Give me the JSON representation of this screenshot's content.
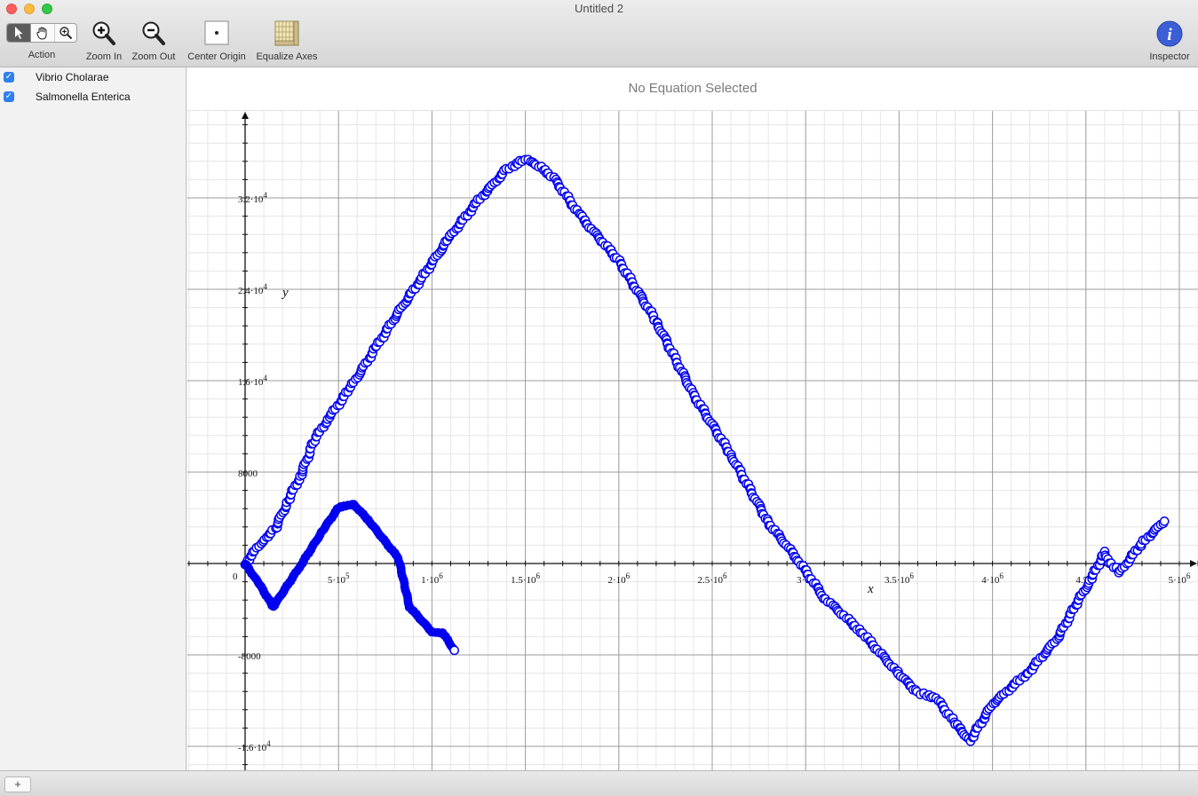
{
  "window": {
    "title": "Untitled 2"
  },
  "toolbar": {
    "action_label": "Action",
    "zoom_in_label": "Zoom In",
    "zoom_out_label": "Zoom Out",
    "center_origin_label": "Center Origin",
    "equalize_axes_label": "Equalize Axes",
    "inspector_label": "Inspector",
    "action_tools": [
      "arrow-pointer",
      "hand-pan",
      "zoom-magnifier"
    ],
    "active_tool": "arrow-pointer"
  },
  "sidebar": {
    "items": [
      {
        "label": "Vibrio Cholarae",
        "checked": true
      },
      {
        "label": "Salmonella Enterica",
        "checked": true
      }
    ]
  },
  "equation_bar": {
    "text": "No Equation Selected"
  },
  "bottom": {
    "add_label": "+"
  },
  "colors": {
    "series": "#0000ee",
    "accent": "#2f7ff0",
    "inspector": "#3c5fd6"
  },
  "chart_data": {
    "type": "scatter",
    "xlabel": "x",
    "ylabel": "y",
    "xlim": [
      -300000,
      5100000
    ],
    "ylim": [
      -18000,
      40000
    ],
    "grid": true,
    "x_ticks": [
      {
        "value": 0,
        "label": "0"
      },
      {
        "value": 500000,
        "label": "5·10",
        "exp": "5"
      },
      {
        "value": 1000000,
        "label": "1·10",
        "exp": "6"
      },
      {
        "value": 1500000,
        "label": "1.5·10",
        "exp": "6"
      },
      {
        "value": 2000000,
        "label": "2·10",
        "exp": "6"
      },
      {
        "value": 2500000,
        "label": "2.5·10",
        "exp": "6"
      },
      {
        "value": 3000000,
        "label": "3·10",
        "exp": ""
      },
      {
        "value": 3500000,
        "label": "3.5·10",
        "exp": "6"
      },
      {
        "value": 4000000,
        "label": "4·10",
        "exp": "6"
      },
      {
        "value": 4500000,
        "label": "4.5·1",
        "exp": ""
      },
      {
        "value": 5000000,
        "label": "5·10",
        "exp": "6"
      }
    ],
    "y_ticks": [
      {
        "value": 32000,
        "label": "3.2·10",
        "exp": "4"
      },
      {
        "value": 24000,
        "label": "2.4·10",
        "exp": "4"
      },
      {
        "value": 16000,
        "label": "1.6·10",
        "exp": "4"
      },
      {
        "value": 8000,
        "label": "8000",
        "exp": ""
      },
      {
        "value": -8000,
        "label": "-8000",
        "exp": ""
      },
      {
        "value": -16000,
        "label": "-1.6·10",
        "exp": "4"
      }
    ],
    "series": [
      {
        "style": "hollow-circles",
        "points": [
          [
            0,
            0
          ],
          [
            100000,
            2100
          ],
          [
            160000,
            3000
          ],
          [
            230000,
            5500
          ],
          [
            300000,
            7800
          ],
          [
            370000,
            10800
          ],
          [
            450000,
            12800
          ],
          [
            560000,
            15300
          ],
          [
            700000,
            18900
          ],
          [
            820000,
            22000
          ],
          [
            950000,
            25100
          ],
          [
            1100000,
            28700
          ],
          [
            1250000,
            31800
          ],
          [
            1400000,
            34500
          ],
          [
            1500000,
            35400
          ],
          [
            1570000,
            34800
          ],
          [
            1650000,
            33800
          ],
          [
            1800000,
            30300
          ],
          [
            2000000,
            26500
          ],
          [
            2200000,
            21200
          ],
          [
            2400000,
            14800
          ],
          [
            2600000,
            9500
          ],
          [
            2800000,
            3600
          ],
          [
            2950000,
            500
          ],
          [
            3100000,
            -3000
          ],
          [
            3300000,
            -6000
          ],
          [
            3500000,
            -9700
          ],
          [
            3600000,
            -11300
          ],
          [
            3700000,
            -11800
          ],
          [
            3800000,
            -14000
          ],
          [
            3880000,
            -15500
          ],
          [
            4000000,
            -12300
          ],
          [
            4200000,
            -9400
          ],
          [
            4350000,
            -6500
          ],
          [
            4450000,
            -3500
          ],
          [
            4530000,
            -1300
          ],
          [
            4600000,
            1000
          ],
          [
            4620000,
            300
          ],
          [
            4680000,
            -800
          ],
          [
            4800000,
            1800
          ],
          [
            4920000,
            3700
          ]
        ]
      },
      {
        "style": "filled-circles",
        "points": [
          [
            0,
            0
          ],
          [
            80000,
            -1900
          ],
          [
            150000,
            -3800
          ],
          [
            300000,
            -100
          ],
          [
            420000,
            3000
          ],
          [
            500000,
            4900
          ],
          [
            580000,
            5200
          ],
          [
            660000,
            3800
          ],
          [
            760000,
            1700
          ],
          [
            820000,
            500
          ],
          [
            880000,
            -3800
          ],
          [
            1000000,
            -6000
          ],
          [
            1060000,
            -6100
          ],
          [
            1120000,
            -7600
          ]
        ]
      }
    ]
  }
}
